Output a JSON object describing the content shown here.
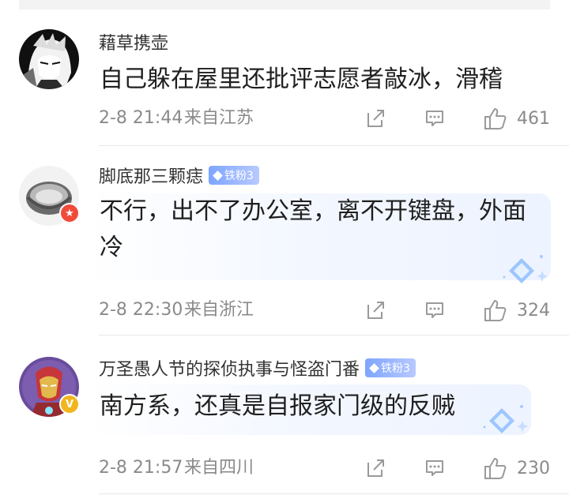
{
  "comments": [
    {
      "username": "藉草携壶",
      "fan_badge": "",
      "text": "自己躲在屋里还批评志愿者敲冰，滑稽",
      "time": "2-8 21:44",
      "location": "来自江苏",
      "likes": "461",
      "avatar": "anime-character-avatar"
    },
    {
      "username": "脚底那三颗痣",
      "fan_badge": "铁粉3",
      "text": "不行，出不了办公室，离不开键盘，外面冷",
      "time": "2-8 22:30",
      "location": "来自浙江",
      "likes": "324",
      "avatar": "pet-bed-avatar"
    },
    {
      "username": "万圣愚人节的探侦执事与怪盗门番",
      "fan_badge": "铁粉3",
      "text": "南方系，还真是自报家门级的反贼",
      "time": "2-8 21:57",
      "location": "来自四川",
      "likes": "230",
      "avatar": "iron-man-avatar"
    }
  ],
  "icons": {
    "share": "share-icon",
    "reply": "comment-icon",
    "like": "thumbs-up-icon",
    "fan_badge": "diamond-icon",
    "verified": "star-badge-icon",
    "gold_verified": "v-badge-icon",
    "decoration": "diamond-sparkle-icon"
  },
  "colors": {
    "text_primary": "#1f1f1f",
    "text_secondary": "#8a8a8a",
    "fan_badge": "#8daeff",
    "highlight_bg": "#edf3ff",
    "red_badge": "#f04b3a",
    "gold_badge": "#f2b51d"
  }
}
